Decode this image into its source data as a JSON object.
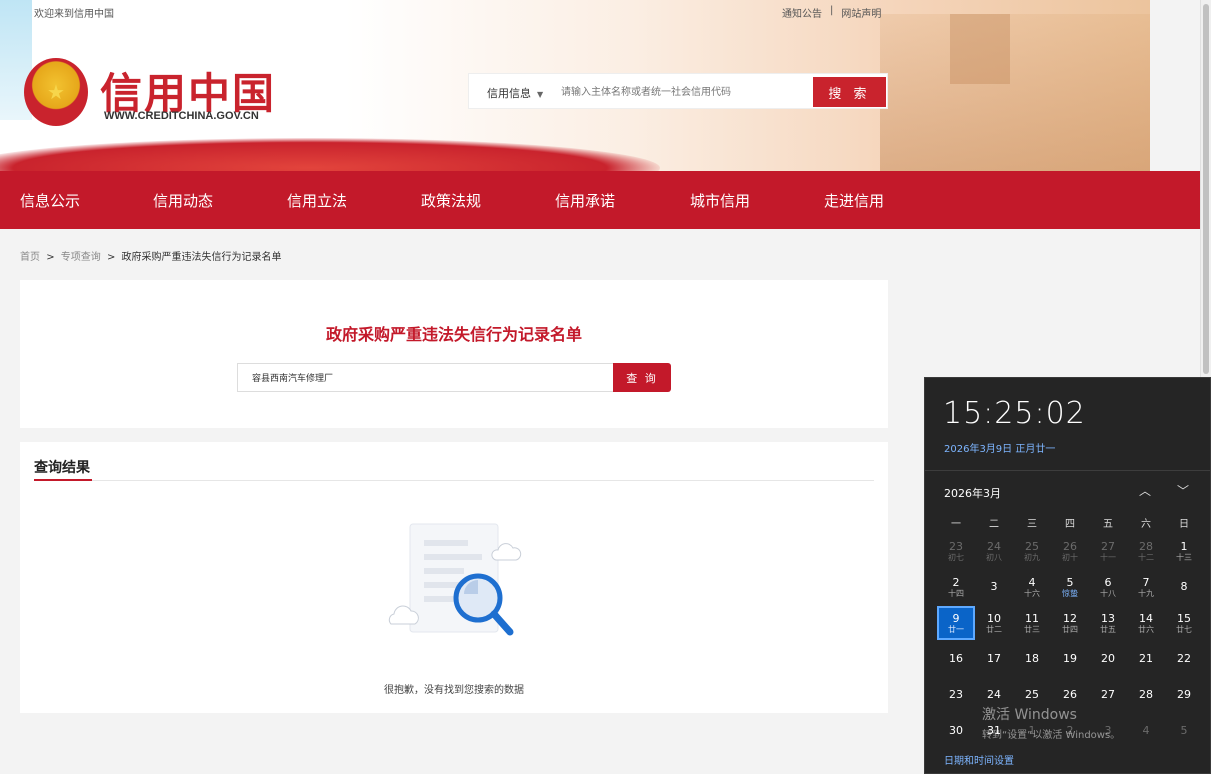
{
  "topbar": {
    "welcome": "欢迎来到信用中国",
    "notice": "通知公告",
    "separator": "|",
    "statement": "网站声明"
  },
  "logo": {
    "cn": "信用中国",
    "en": "WWW.CREDITCHINA.GOV.CN"
  },
  "header_search": {
    "type_label": "信用信息",
    "caret": "▼",
    "placeholder": "请输入主体名称或者统一社会信用代码",
    "button": "搜 索"
  },
  "nav": {
    "items": [
      "信息公示",
      "信用动态",
      "信用立法",
      "政策法规",
      "信用承诺",
      "城市信用",
      "走进信用"
    ]
  },
  "breadcrumb": {
    "home": "首页",
    "sep1": ">",
    "category": "专项查询",
    "sep2": ">",
    "current": "政府采购严重违法失信行为记录名单"
  },
  "query": {
    "title": "政府采购严重违法失信行为记录名单",
    "input_value": "容县西南汽车修理厂",
    "button": "查 询"
  },
  "results": {
    "title": "查询结果",
    "empty_message": "很抱歉，没有找到您搜索的数据"
  },
  "clock": {
    "time": "15:25:02",
    "date": "2026年3月9日 正月廿一",
    "month": "2026年3月",
    "up": "︿",
    "down": "﹀",
    "weekdays": [
      "一",
      "二",
      "三",
      "四",
      "五",
      "六",
      "日"
    ],
    "weeks": [
      [
        {
          "d": "23",
          "l": "初七",
          "other": true
        },
        {
          "d": "24",
          "l": "初八",
          "other": true
        },
        {
          "d": "25",
          "l": "初九",
          "other": true
        },
        {
          "d": "26",
          "l": "初十",
          "other": true
        },
        {
          "d": "27",
          "l": "十一",
          "other": true
        },
        {
          "d": "28",
          "l": "十二",
          "other": true
        },
        {
          "d": "1",
          "l": "十三"
        }
      ],
      [
        {
          "d": "2",
          "l": "十四"
        },
        {
          "d": "3",
          "l": ""
        },
        {
          "d": "4",
          "l": "十六"
        },
        {
          "d": "5",
          "l": "惊蛰"
        },
        {
          "d": "6",
          "l": "十八"
        },
        {
          "d": "7",
          "l": "十九"
        },
        {
          "d": "8",
          "l": ""
        }
      ],
      [
        {
          "d": "9",
          "l": "廿一",
          "today": true
        },
        {
          "d": "10",
          "l": "廿二"
        },
        {
          "d": "11",
          "l": "廿三"
        },
        {
          "d": "12",
          "l": "廿四"
        },
        {
          "d": "13",
          "l": "廿五"
        },
        {
          "d": "14",
          "l": "廿六"
        },
        {
          "d": "15",
          "l": "廿七"
        }
      ],
      [
        {
          "d": "16",
          "l": ""
        },
        {
          "d": "17",
          "l": ""
        },
        {
          "d": "18",
          "l": ""
        },
        {
          "d": "19",
          "l": ""
        },
        {
          "d": "20",
          "l": ""
        },
        {
          "d": "21",
          "l": ""
        },
        {
          "d": "22",
          "l": ""
        }
      ],
      [
        {
          "d": "23",
          "l": ""
        },
        {
          "d": "24",
          "l": ""
        },
        {
          "d": "25",
          "l": ""
        },
        {
          "d": "26",
          "l": ""
        },
        {
          "d": "27",
          "l": ""
        },
        {
          "d": "28",
          "l": ""
        },
        {
          "d": "29",
          "l": ""
        }
      ],
      [
        {
          "d": "30",
          "l": ""
        },
        {
          "d": "31",
          "l": ""
        },
        {
          "d": "1",
          "l": "",
          "other": true
        },
        {
          "d": "2",
          "l": "",
          "other": true
        },
        {
          "d": "3",
          "l": "",
          "other": true
        },
        {
          "d": "4",
          "l": "",
          "other": true
        },
        {
          "d": "5",
          "l": "",
          "other": true
        }
      ]
    ],
    "watermark_line1": "激活 Windows",
    "watermark_line2": "转到“设置”以激活 Windows。",
    "settings_link": "日期和时间设置"
  },
  "colors": {
    "brand_red": "#c3192a",
    "flyout_bg": "#252525",
    "today_blue": "#0a64c8",
    "link_blue": "#7db5ff"
  }
}
